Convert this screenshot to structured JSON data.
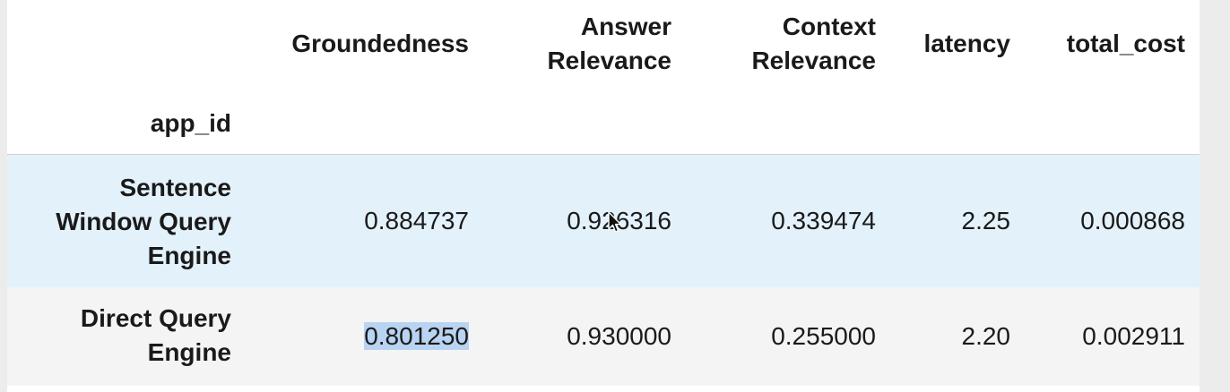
{
  "table": {
    "index_name": "app_id",
    "columns": [
      {
        "line1": "Groundedness",
        "line2": ""
      },
      {
        "line1": "Answer",
        "line2": "Relevance"
      },
      {
        "line1": "Context",
        "line2": "Relevance"
      },
      {
        "line1": "latency",
        "line2": ""
      },
      {
        "line1": "total_cost",
        "line2": ""
      }
    ],
    "rows": [
      {
        "app_id_lines": [
          "Sentence",
          "Window Query",
          "Engine"
        ],
        "values": [
          "0.884737",
          "0.926316",
          "0.339474",
          "2.25",
          "0.000868"
        ]
      },
      {
        "app_id_lines": [
          "Direct Query",
          "Engine"
        ],
        "values": [
          "0.801250",
          "0.930000",
          "0.255000",
          "2.20",
          "0.002911"
        ]
      }
    ],
    "selected_text": "0.801250"
  },
  "colors": {
    "row_highlight": "#e3f1fb",
    "row_alt": "#f4f4f4",
    "selection": "#b9d3f2"
  },
  "icons": {
    "cursor": "mouse-pointer-icon"
  }
}
